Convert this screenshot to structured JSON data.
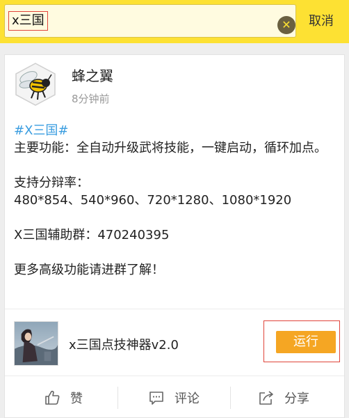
{
  "search": {
    "query": "x三国",
    "cancel_label": "取消"
  },
  "post": {
    "author": "蜂之翼",
    "time": "8分钟前",
    "hashtag": "#X三国#",
    "paragraphs": [
      "主要功能：全自动升级武将技能，一键启动，循环加点。",
      "支持分辩率：\n480*854、540*960、720*1280、1080*1920",
      "X三国辅助群：470240395",
      "更多高级功能请进群了解！"
    ],
    "app": {
      "name": "x三国点技神器v2.0",
      "run_label": "运行"
    },
    "actions": {
      "like_label": "赞",
      "comment_label": "评论",
      "share_label": "分享"
    }
  },
  "colors": {
    "header_yellow": "#fde133",
    "run_orange": "#f5a623",
    "hashtag_blue": "#3a9de0",
    "highlight_red": "#e0443a"
  },
  "icons": [
    "clear-icon",
    "avatar-bee-logo",
    "app-thumbnail",
    "thumbs-up-icon",
    "comment-icon",
    "share-icon"
  ]
}
